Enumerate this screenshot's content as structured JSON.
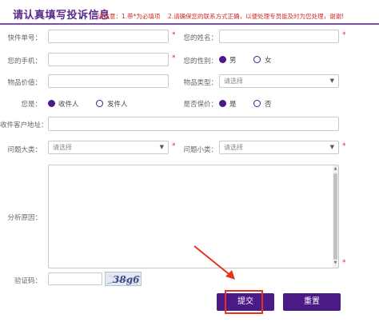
{
  "header": {
    "title": "请认真填写投诉信息",
    "note1": "请注意：1.带*为必填项",
    "note2": "2.请确保您的联系方式正确，以便处理专员能及时为您处理，谢谢!"
  },
  "form": {
    "tracking_label": "快件单号：",
    "name_label": "您的姓名：",
    "phone_label": "您的手机：",
    "gender_label": "您的性别：",
    "gender_male": "男",
    "gender_female": "女",
    "value_label": "物品价值：",
    "item_type_label": "物品类型：",
    "item_type_value": "请选择",
    "role_label": "您是：",
    "role_receiver": "收件人",
    "role_sender": "发件人",
    "insured_label": "是否保价：",
    "insured_yes": "是",
    "insured_no": "否",
    "address_label": "收件客户地址：",
    "issue_major_label": "问题大类：",
    "issue_major_value": "请选择",
    "issue_minor_label": "问题小类：",
    "issue_minor_value": "请选择",
    "analysis_label": "分析原因：",
    "captcha_label": "验证码：",
    "captcha_text": "38g6",
    "required_mark": "*"
  },
  "buttons": {
    "submit": "提交",
    "reset": "重置"
  },
  "icons": {
    "chevron": "chevron-down-icon"
  },
  "colors": {
    "accent": "#4b1a86",
    "required": "#d42a2a",
    "highlight": "#e8321e"
  }
}
